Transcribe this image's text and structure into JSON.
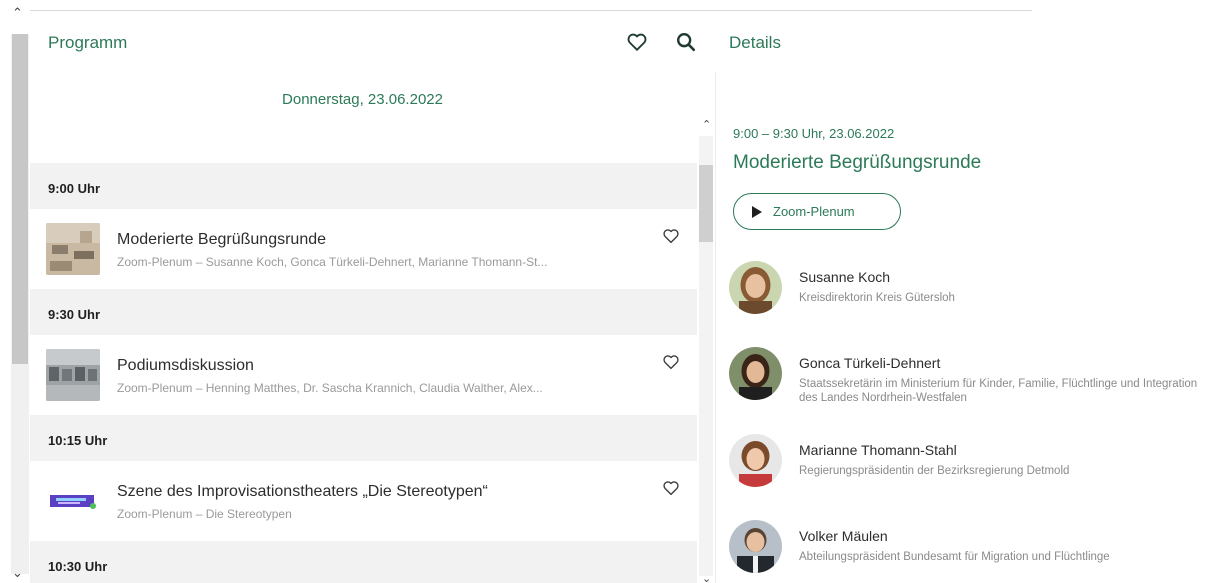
{
  "program": {
    "title": "Programm",
    "date": "Donnerstag, 23.06.2022",
    "sessions": [
      {
        "time": "9:00 Uhr",
        "title": "Moderierte Begrüßungsrunde",
        "subtitle": "Zoom-Plenum – Susanne Koch, Gonca Türkeli-Dehnert, Marianne Thomann-St..."
      },
      {
        "time": "9:30 Uhr",
        "title": "Podiumsdiskussion",
        "subtitle": "Zoom-Plenum – Henning Matthes, Dr. Sascha Krannich, Claudia Walther, Alex..."
      },
      {
        "time": "10:15 Uhr",
        "title": "Szene des Improvisationstheaters „Die Stereotypen“",
        "subtitle": "Zoom-Plenum – Die Stereotypen"
      },
      {
        "time": "10:30 Uhr"
      }
    ]
  },
  "details": {
    "title": "Details",
    "time": "9:00 – 9:30 Uhr, 23.06.2022",
    "session_title": "Moderierte Begrüßungsrunde",
    "room_button": "Zoom-Plenum",
    "speakers": [
      {
        "name": "Susanne Koch",
        "role": "Kreisdirektorin Kreis Gütersloh"
      },
      {
        "name": "Gonca Türkeli-Dehnert",
        "role": "Staatssekretärin im Ministerium für Kinder, Familie, Flüchtlinge und Integration des Landes Nordrhein-Westfalen"
      },
      {
        "name": "Marianne Thomann-Stahl",
        "role": "Regierungspräsidentin der Bezirksregierung Detmold"
      },
      {
        "name": "Volker Mäulen",
        "role": "Abteilungspräsident Bundesamt für Migration und Flüchtlinge"
      }
    ]
  },
  "icons": {
    "favorites": "heart-outline-icon",
    "search": "search-icon",
    "play": "play-icon"
  },
  "colors": {
    "accent": "#2c7a58",
    "time_row_bg": "#f2f2f2",
    "muted_text": "#9a9a9a"
  }
}
